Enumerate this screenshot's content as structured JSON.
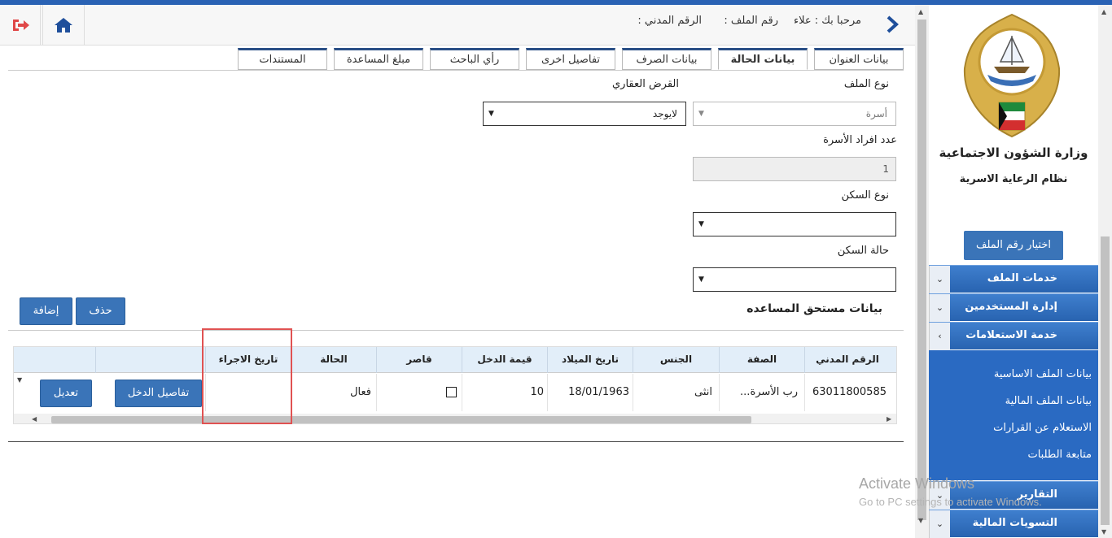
{
  "header": {
    "welcome_text": "مرحبا بك : علاء",
    "file_no_label": "رقم الملف :",
    "civil_id_label": "الرقم المدني :"
  },
  "tabs": [
    {
      "label": "بيانات العنوان",
      "active": false
    },
    {
      "label": "بيانات الحالة",
      "active": true
    },
    {
      "label": "بيانات الصرف",
      "active": false
    },
    {
      "label": "تفاصيل اخرى",
      "active": false
    },
    {
      "label": "رأي الباحث",
      "active": false
    },
    {
      "label": "مبلغ المساعدة",
      "active": false
    },
    {
      "label": "المستندات",
      "active": false
    }
  ],
  "form": {
    "file_type_label": "نوع الملف",
    "file_type_value": "أسرة",
    "real_estate_loan_label": "القرض العقاري",
    "real_estate_loan_value": "لايوجد",
    "family_count_label": "عدد افراد الأسرة",
    "family_count_value": "1",
    "housing_type_label": "نوع السكن",
    "housing_type_value": "",
    "housing_status_label": "حالة السكن",
    "housing_status_value": ""
  },
  "section": {
    "title": "بيانات مستحق المساعده",
    "delete_label": "حذف",
    "add_label": "إضافة"
  },
  "table": {
    "headers": [
      "الرقم المدني",
      "الصفة",
      "الجنس",
      "تاريخ الميلاد",
      "قيمة الدخل",
      "قاصر",
      "الحالة",
      "تاريخ الاجراء"
    ],
    "row": {
      "civil_id": "63011800585",
      "relation": "رب الأسرة...",
      "gender": "انثى",
      "birth_date": "18/01/1963",
      "income": "10",
      "minor": false,
      "status": "فعال",
      "action_date": "",
      "income_details_label": "تفاصيل الدخل",
      "edit_label": "تعديل"
    }
  },
  "sidebar": {
    "ministry_name": "وزارة الشؤون الاجتماعية",
    "system_name": "نظام الرعاية الاسرية",
    "choose_file_label": "اختيار رقم الملف",
    "menu": [
      {
        "label": "خدمات الملف",
        "chevron": "⌄"
      },
      {
        "label": "إدارة المستخدمين",
        "chevron": "⌄"
      },
      {
        "label": "خدمة الاستعلامات",
        "chevron": "›"
      }
    ],
    "submenu": [
      "بيانات الملف الاساسية",
      "بيانات الملف المالية",
      "الاستعلام عن القرارات",
      "متابعة الطلبات"
    ],
    "menu_bottom": [
      {
        "label": "التقارير",
        "chevron": "⌄"
      },
      {
        "label": "التسويات المالية",
        "chevron": "⌄"
      }
    ]
  },
  "watermark": {
    "line1": "Activate Windows",
    "line2": "Go to PC settings to activate Windows."
  },
  "colors": {
    "accent": "#3a74b8",
    "menu": "#2a6ac2",
    "highlight": "#e05252"
  }
}
